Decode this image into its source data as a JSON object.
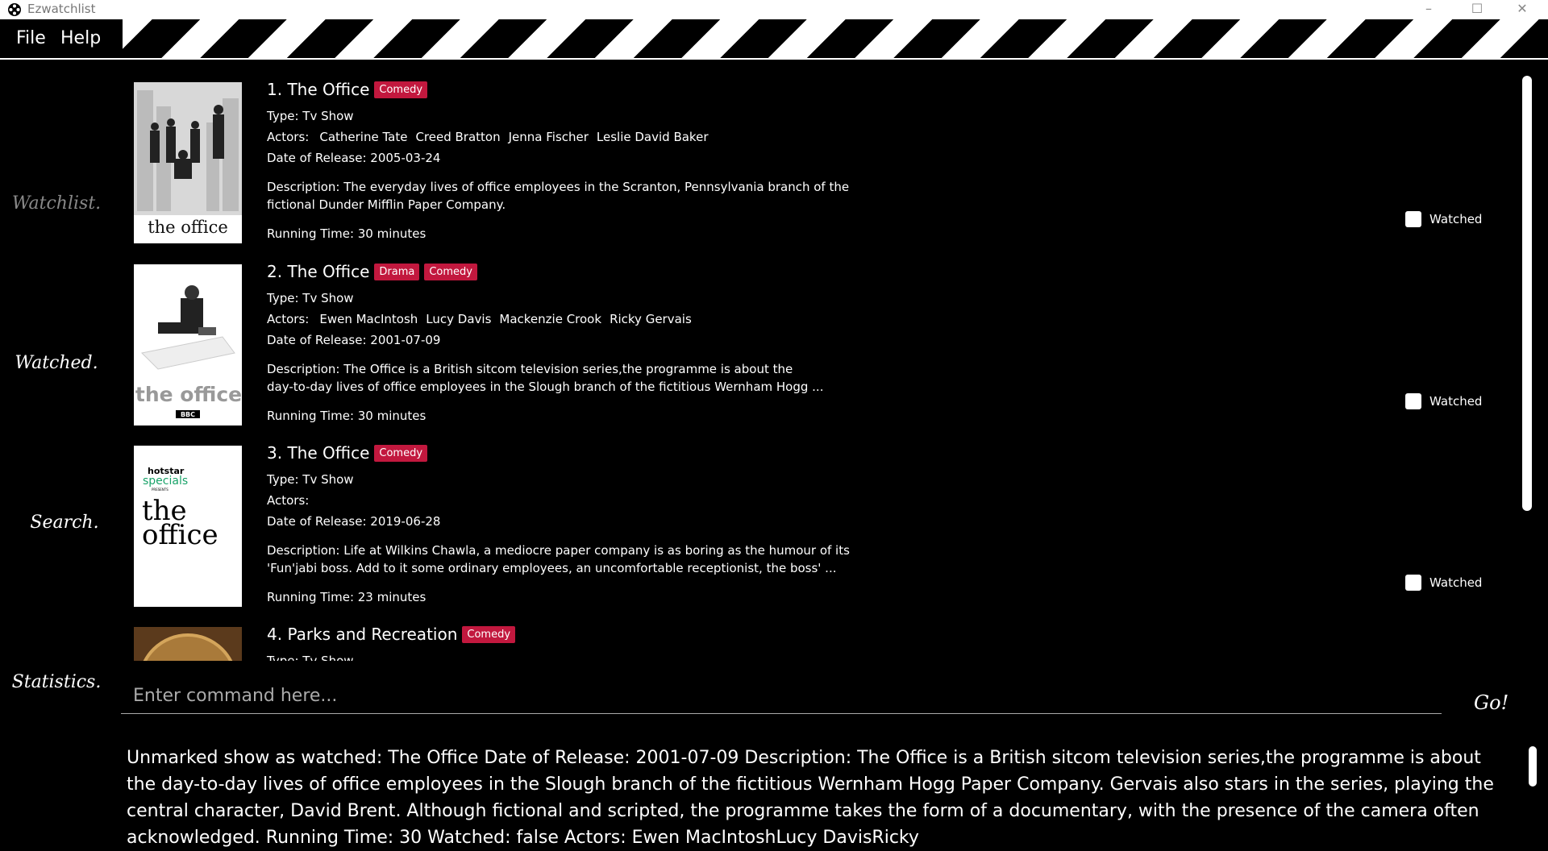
{
  "window": {
    "title": "Ezwatchlist",
    "minimize": "–",
    "maximize": "☐",
    "close": "✕"
  },
  "menu": {
    "file": "File",
    "help": "Help"
  },
  "nav": {
    "watchlist": "Watchlist.",
    "watched": "Watched.",
    "search": "Search.",
    "statistics": "Statistics."
  },
  "shows": [
    {
      "title": "1.  The Office",
      "genres": [
        "Comedy"
      ],
      "type": "Type: Tv Show",
      "actors_label": "Actors:",
      "actors": [
        "Catherine Tate",
        "Creed Bratton",
        "Jenna Fischer",
        "Leslie David Baker"
      ],
      "release": "Date of Release: 2005-03-24",
      "desc1": "Description: The everyday lives of office employees in the Scranton, Pennsylvania branch of the",
      "desc2": "fictional Dunder Mifflin Paper Company.",
      "runtime": "Running Time: 30 minutes",
      "watched_label": "Watched",
      "poster_text": "the office"
    },
    {
      "title": "2.  The Office",
      "genres": [
        "Drama",
        "Comedy"
      ],
      "type": "Type: Tv Show",
      "actors_label": "Actors:",
      "actors": [
        "Ewen MacIntosh",
        "Lucy Davis",
        "Mackenzie Crook",
        "Ricky Gervais"
      ],
      "release": "Date of Release: 2001-07-09",
      "desc1": "Description: The Office is a British sitcom television series,the programme is about the",
      "desc2": "day-to-day lives of office employees in the Slough branch of the fictitious Wernham Hogg ...",
      "runtime": "Running Time: 30 minutes",
      "watched_label": "Watched",
      "poster_text": "the office",
      "poster_sub": "BBC"
    },
    {
      "title": "3.  The Office",
      "genres": [
        "Comedy"
      ],
      "type": "Type: Tv Show",
      "actors_label": "Actors:",
      "actors": [],
      "release": "Date of Release: 2019-06-28",
      "desc1": "Description: Life at Wilkins Chawla, a mediocre paper company is as boring as the humour of its",
      "desc2": "'Fun'jabi boss. Add to it some ordinary employees, an uncomfortable receptionist, the boss' ...",
      "runtime": "Running Time: 23 minutes",
      "watched_label": "Watched",
      "poster_brand": "hotstar",
      "poster_specials": "specials",
      "poster_presents": "PRESENTS",
      "poster_text1": "the",
      "poster_text2": "office"
    },
    {
      "title": "4.  Parks and Recreation",
      "genres": [
        "Comedy"
      ],
      "type": "Type: Tv Show"
    }
  ],
  "command": {
    "placeholder": "Enter command here...",
    "go": "Go!"
  },
  "result": "Unmarked show as watched: The Office Date of Release: 2001-07-09 Description: The Office is a British sitcom television series,the programme is about the day-to-day lives of office employees in the Slough branch of the fictitious Wernham Hogg Paper Company. Gervais also stars in the series, playing the central character, David Brent. Although fictional and scripted, the programme takes the form of a documentary, with the presence of the camera often acknowledged. Running Time: 30 Watched: false Actors: Ewen MacIntoshLucy DavisRicky",
  "colors": {
    "genre_tag": "#c2183e",
    "background": "#000000"
  }
}
